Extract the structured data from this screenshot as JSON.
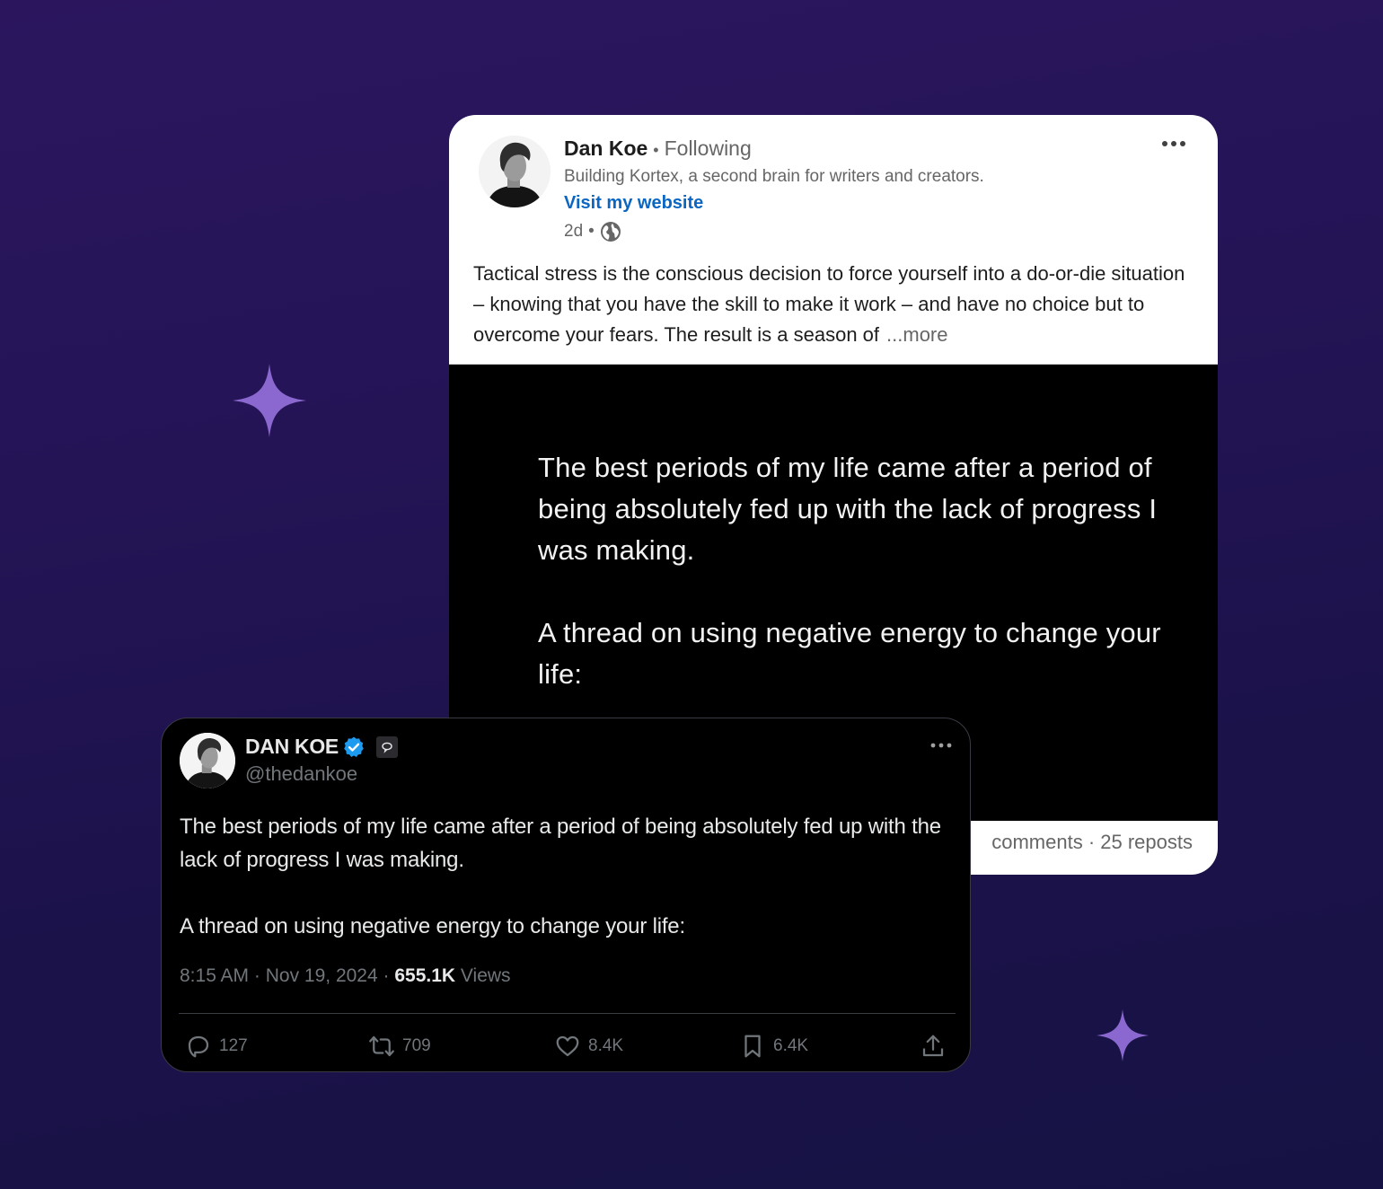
{
  "colors": {
    "sparkle": "#8a68d0",
    "linkedin_link": "#0a66c2",
    "twitter_verified": "#1d9bf0"
  },
  "linkedin_post": {
    "author_name": "Dan Koe",
    "separator": "•",
    "follow_status": "Following",
    "headline": "Building Kortex, a second brain for writers and creators.",
    "website_link": "Visit my website",
    "time_ago": "2d",
    "meta_separator": "•",
    "visibility_icon": "globe-icon",
    "body_text": "Tactical stress is the conscious decision to force yourself into a do-or-die situation – knowing that you have the skill to make it work – and have no choice but to overcome your fears. The result is a season of",
    "see_more": "...more",
    "image_text": "The best periods of my life came after a period of being absolutely fed up with the lack of progress I was making.\n\nA thread on using negative energy to change your life:",
    "footer_stats": "comments · 25 reposts",
    "more_icon": "ellipsis-icon"
  },
  "tweet": {
    "display_name": "DAN KOE",
    "verified_icon": "verified-badge-icon",
    "affiliation_icon": "affiliation-badge-icon",
    "handle": "@thedankoe",
    "text": "The best periods of my life came after a period of being absolutely fed up with the lack of progress I was making.\n\nA thread on using negative energy to change your life:",
    "time": "8:15 AM",
    "dot": " · ",
    "date": "Nov 19, 2024",
    "views_count": "655.1K",
    "views_label": "Views",
    "actions": {
      "replies": "127",
      "reposts": "709",
      "likes": "8.4K",
      "bookmarks": "6.4K"
    }
  }
}
